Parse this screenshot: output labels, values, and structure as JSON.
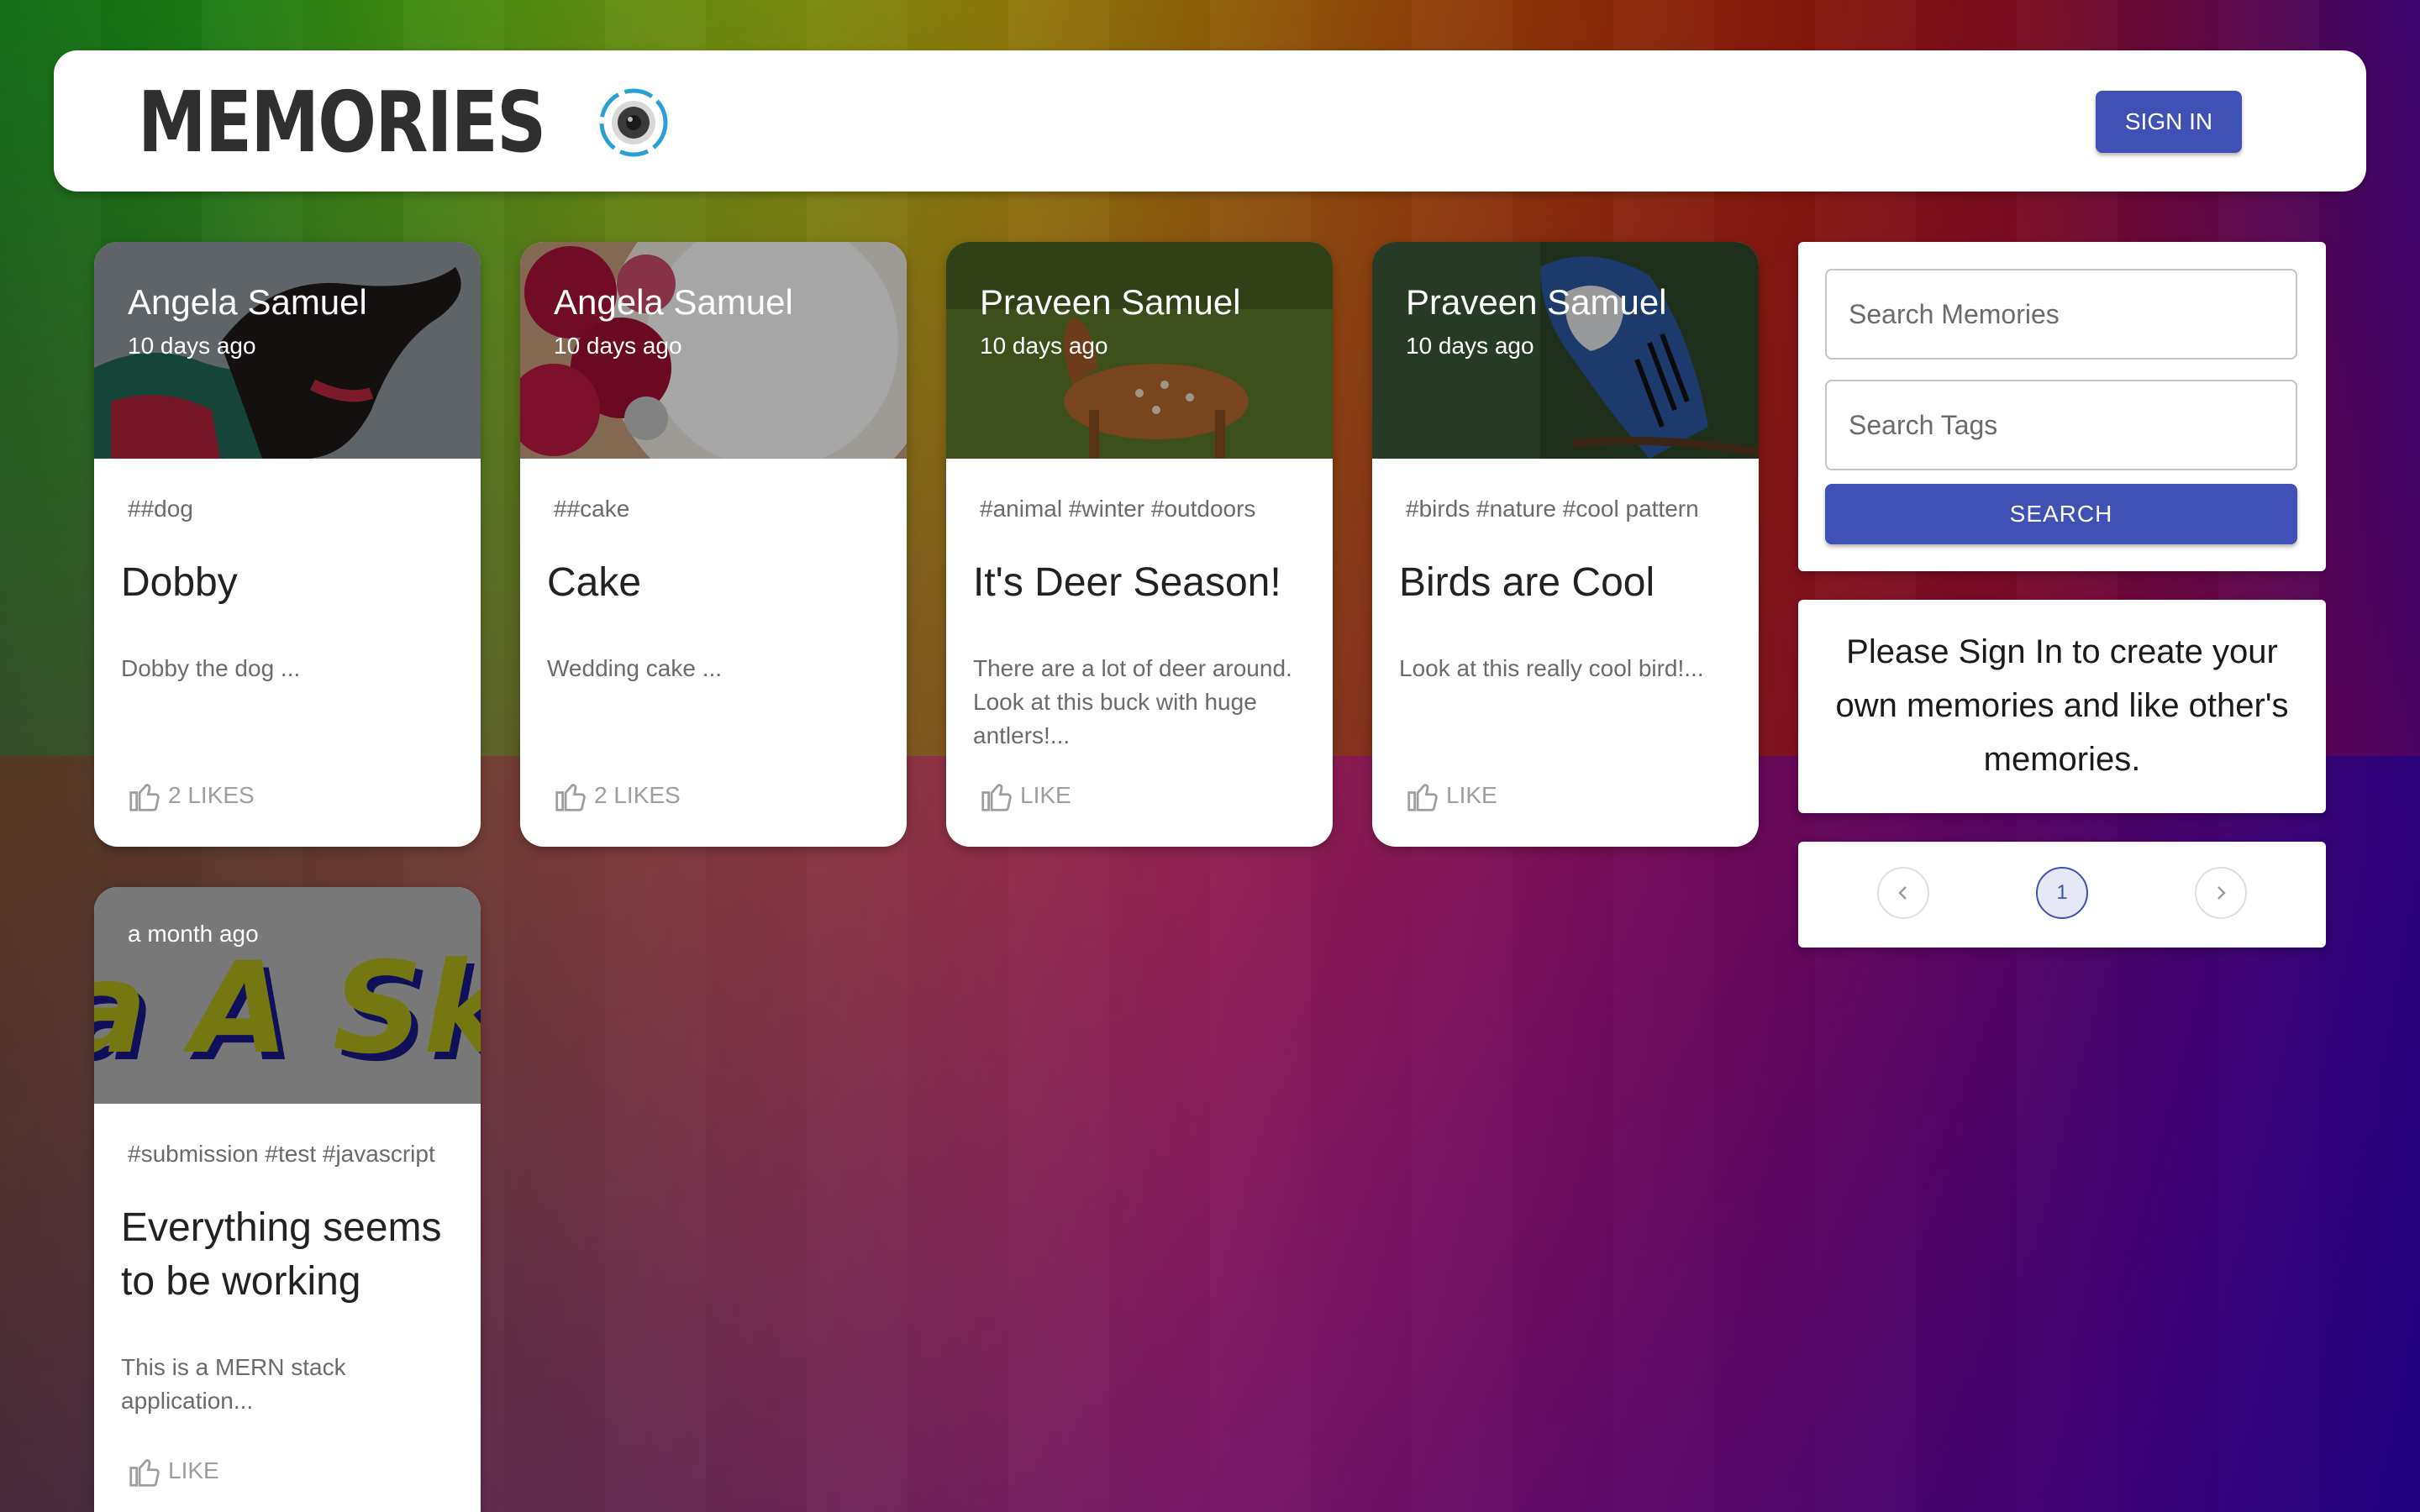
{
  "header": {
    "brand": "Memories",
    "signin_label": "SIGN IN"
  },
  "posts": [
    {
      "author": "Angela Samuel",
      "time": "10 days ago",
      "tags": "##dog",
      "title": "Dobby",
      "message": "Dobby the dog ...",
      "likes": "2 LIKES",
      "image": "dog"
    },
    {
      "author": "Angela Samuel",
      "time": "10 days ago",
      "tags": "##cake",
      "title": "Cake",
      "message": "Wedding cake ...",
      "likes": "2 LIKES",
      "image": "cake"
    },
    {
      "author": "Praveen Samuel",
      "time": "10 days ago",
      "tags": "#animal #winter #outdoors",
      "title": "It's Deer Season!",
      "message": "There are a lot of deer around. Look at this buck with huge antlers!...",
      "likes": "LIKE",
      "image": "deer"
    },
    {
      "author": "Praveen Samuel",
      "time": "10 days ago",
      "tags": "#birds #nature #cool pattern",
      "title": "Birds are Cool",
      "message": "Look at this really cool bird!...",
      "likes": "LIKE",
      "image": "bird"
    },
    {
      "author": "",
      "time": "a month ago",
      "tags": "#submission #test #javascript",
      "title": "Everything seems to be working",
      "message": "This is a MERN stack application...",
      "likes": "LIKE",
      "image": "sketch"
    }
  ],
  "search": {
    "memories_placeholder": "Search Memories",
    "tags_placeholder": "Search Tags",
    "button_label": "SEARCH"
  },
  "notice": "Please Sign In to create your own memories and like other's memories.",
  "pagination": {
    "current_page": "1",
    "prev_icon": "chevron-left-icon",
    "next_icon": "chevron-right-icon"
  },
  "colors": {
    "primary": "#3f51b5",
    "card_bg": "#ffffff",
    "muted_text": "#6b6b6b",
    "like_text": "#9e9e9e"
  }
}
